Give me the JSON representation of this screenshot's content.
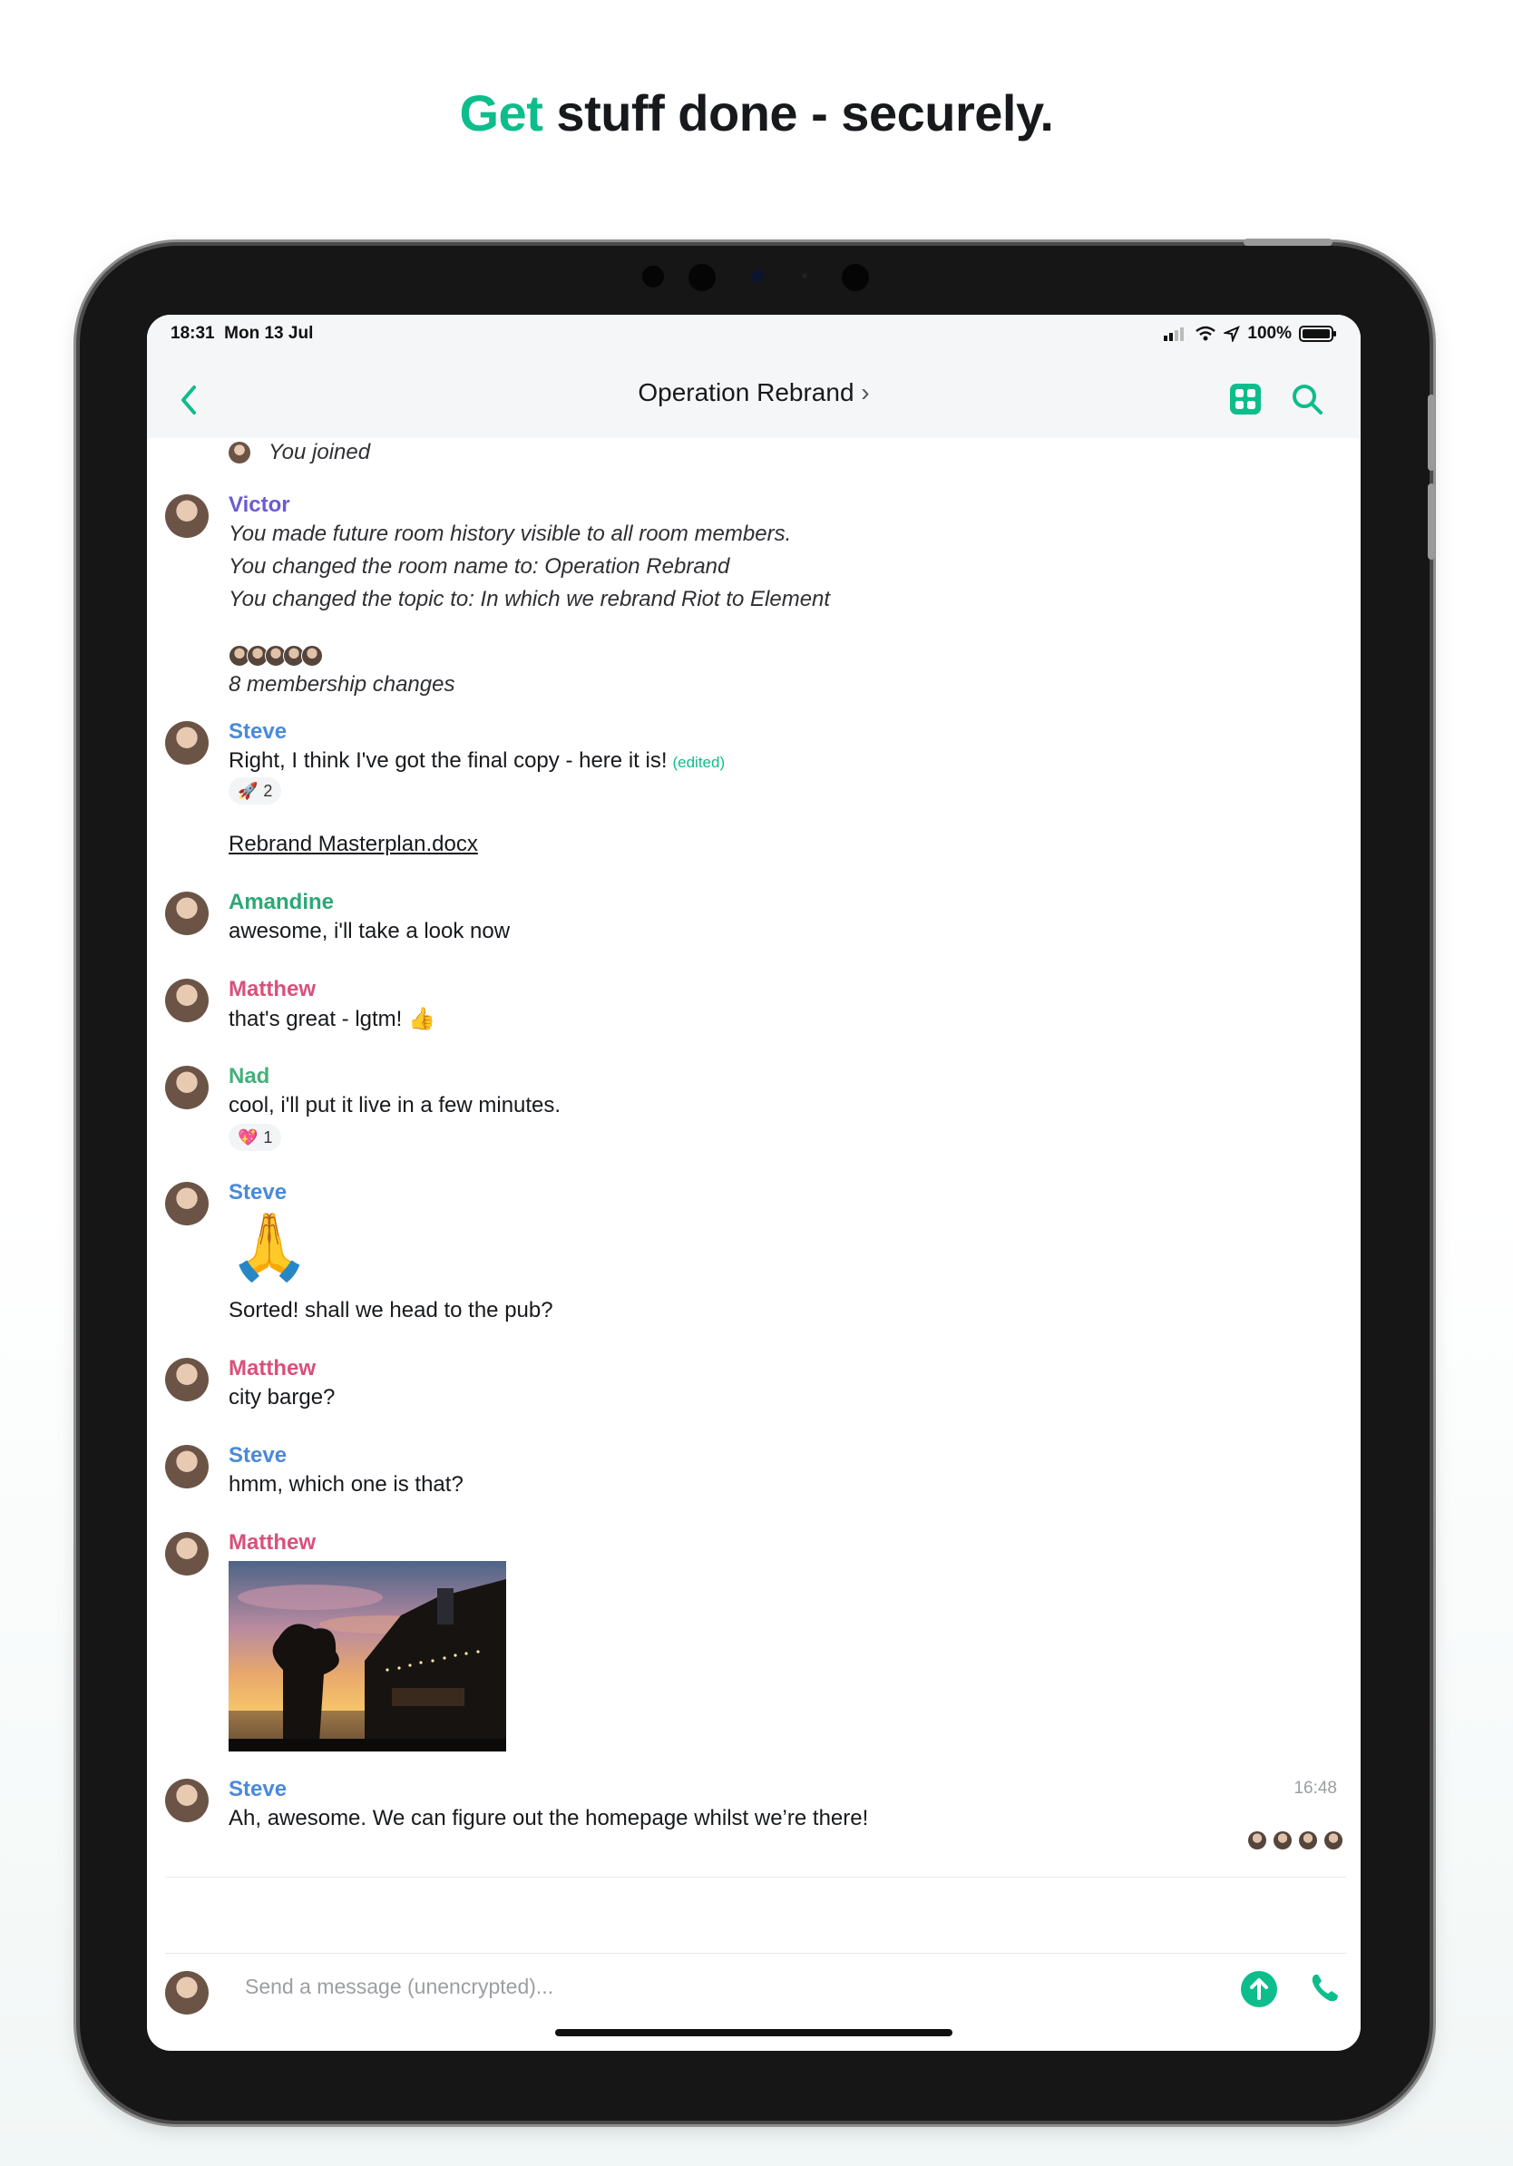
{
  "headline": {
    "accent": "Get",
    "rest": " stuff done - securely."
  },
  "status_bar": {
    "time": "18:31",
    "date": "Mon 13 Jul",
    "battery": "100%"
  },
  "room": {
    "title": "Operation Rebrand",
    "title_chevron": "›"
  },
  "colors": {
    "accent": "#0dbd8b",
    "victor": "#6b5bd5",
    "steve": "#4a8ad8",
    "amandine": "#2aa876",
    "matthew": "#d9507a",
    "nad": "#44b07a"
  },
  "events": {
    "you_joined": "You joined",
    "victor": {
      "name": "Victor",
      "lines": [
        "You made future room history visible to all room members.",
        "You changed the room name to: Operation Rebrand",
        "You changed the topic to: In which we rebrand Riot to Element"
      ]
    },
    "membership": "8 membership changes"
  },
  "messages": {
    "m1": {
      "sender": "Steve",
      "text": "Right, I think I've got the final copy - here it is!",
      "edited": "(edited)",
      "reaction": {
        "emoji": "🚀",
        "count": "2"
      },
      "file": "Rebrand Masterplan.docx"
    },
    "m2": {
      "sender": "Amandine",
      "text": "awesome, i'll take a look now"
    },
    "m3": {
      "sender": "Matthew",
      "text": "that's great - lgtm! 👍"
    },
    "m4": {
      "sender": "Nad",
      "text": "cool, i'll put it live in a few minutes.",
      "reaction": {
        "emoji": "💖",
        "count": "1"
      }
    },
    "m5": {
      "sender": "Steve",
      "emoji": "🙏",
      "text": "Sorted! shall we head to the pub?"
    },
    "m6": {
      "sender": "Matthew",
      "text": "city barge?"
    },
    "m7": {
      "sender": "Steve",
      "text": "hmm, which one is that?"
    },
    "m8": {
      "sender": "Matthew"
    },
    "m9": {
      "sender": "Steve",
      "text": "Ah, awesome. We can figure out the homepage whilst we’re there!",
      "time": "16:48"
    }
  },
  "composer": {
    "placeholder": "Send a message (unencrypted)..."
  }
}
